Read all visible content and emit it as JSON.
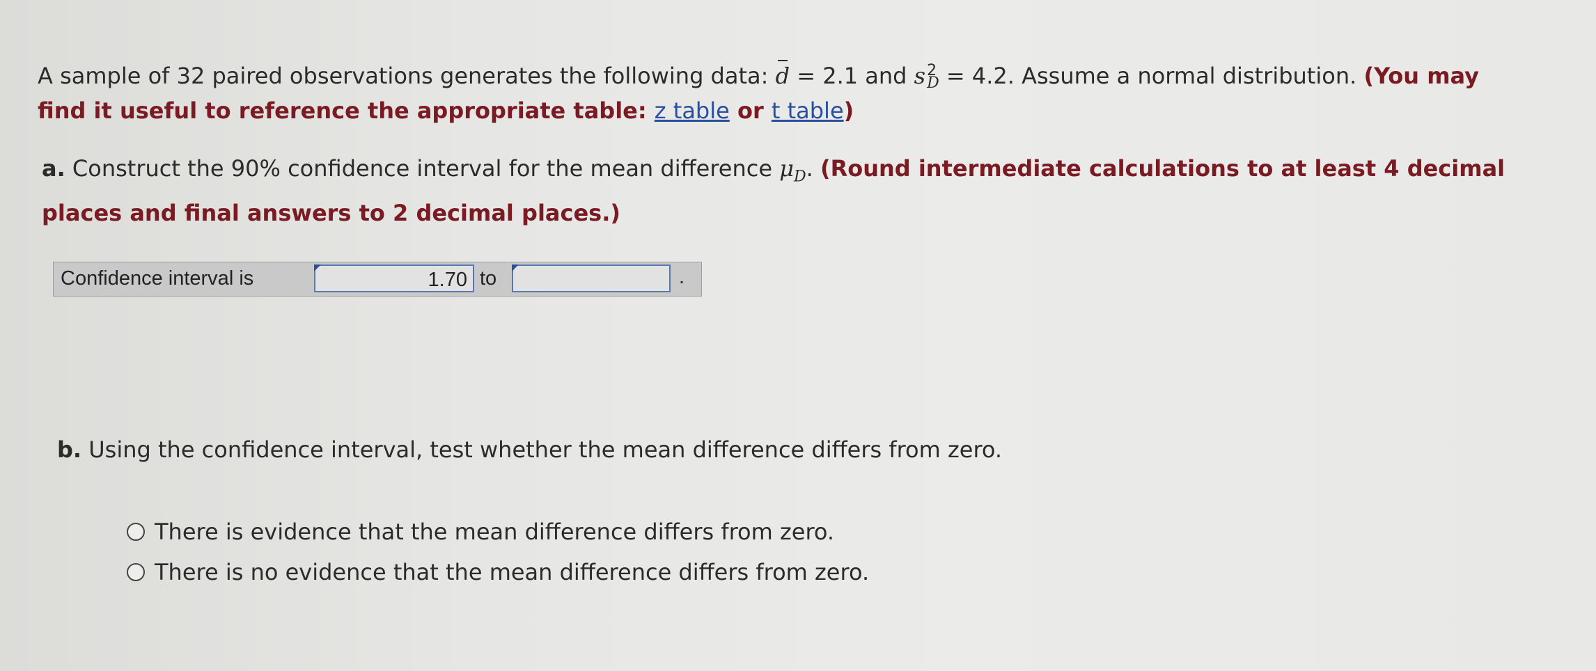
{
  "intro": {
    "text1": "A sample of 32 paired observations generates the following data: ",
    "dbar_symbol": "d",
    "d_value": " = 2.1 and ",
    "s_symbol": "s",
    "s_sup": "2",
    "s_sub": "D",
    "s_value": " = 4.2. Assume a normal distribution. ",
    "hint_start": "(You may find it useful to reference the appropriate table: ",
    "z_link": "z table",
    "or_text": " or ",
    "t_link": "t table",
    "hint_end": ")"
  },
  "part_a": {
    "letter": "a.",
    "text": " Construct the 90% confidence interval for the mean difference ",
    "mu_symbol": "μ",
    "mu_sub": "D",
    "period": ". ",
    "instruction": "(Round intermediate calculations to at least 4 decimal places and final answers to 2 decimal places.)"
  },
  "ci": {
    "label": "Confidence interval is",
    "lower_value": "1.70",
    "to_text": "to",
    "upper_value": "",
    "end_dot": "."
  },
  "part_b": {
    "letter": "b.",
    "text": " Using the confidence interval, test whether the mean difference differs from zero."
  },
  "options": [
    {
      "label": "There is evidence that the mean difference differs from zero."
    },
    {
      "label": "There is no evidence that the mean difference differs from zero."
    }
  ]
}
